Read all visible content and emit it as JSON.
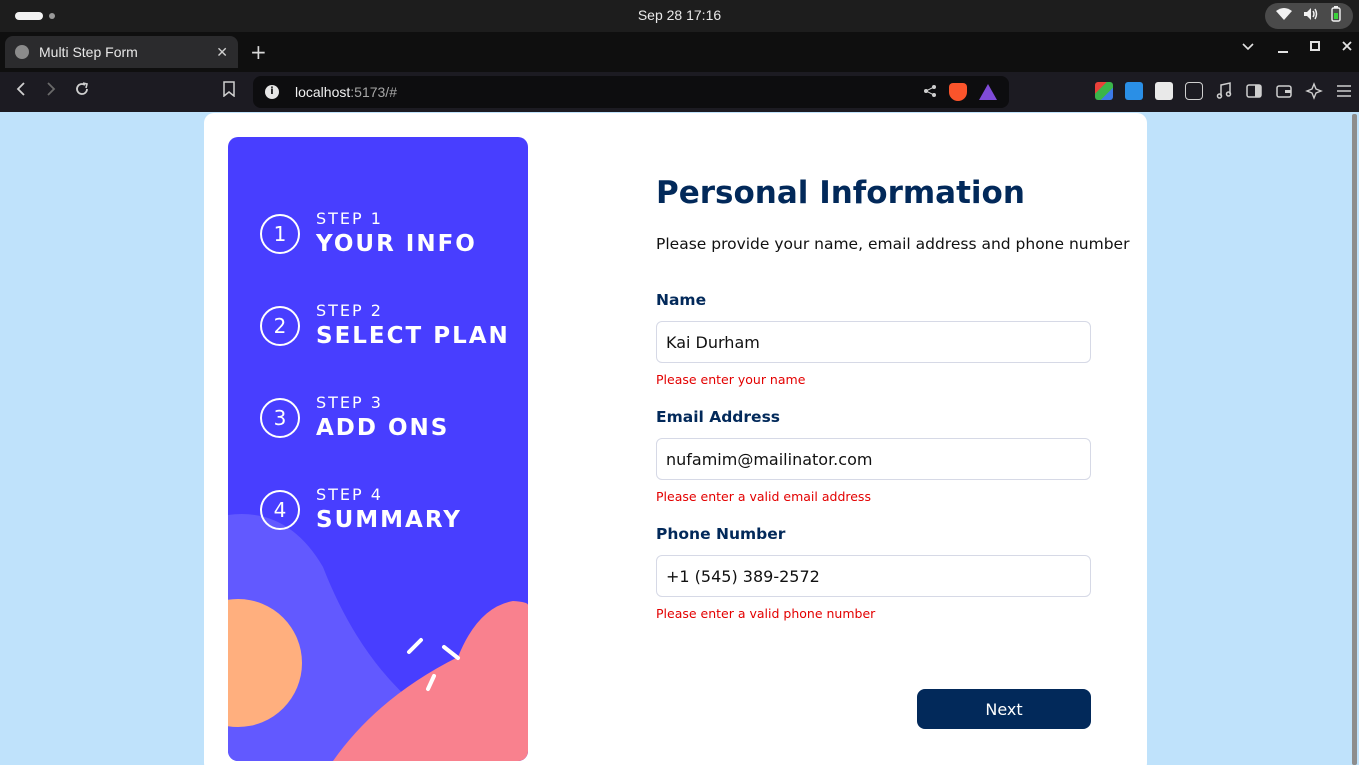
{
  "os": {
    "clock": "Sep 28  17:16",
    "tray_icons": [
      "wifi-icon",
      "volume-icon",
      "battery-icon"
    ]
  },
  "browser": {
    "tab_title": "Multi Step Form",
    "tab_close": "✕",
    "new_tab": "+",
    "url_host": "localhost",
    "url_rest": ":5173/#",
    "extensions": [
      "extension-multicolor-icon",
      "extension-fi-icon",
      "extension-formula-icon",
      "puzzle-icon",
      "music-icon",
      "sidebar-icon",
      "wallet-icon",
      "leo-icon",
      "menu-icon"
    ]
  },
  "sidebar": {
    "steps": [
      {
        "number": "1",
        "label": "STEP 1",
        "title": "YOUR INFO"
      },
      {
        "number": "2",
        "label": "STEP 2",
        "title": "SELECT PLAN"
      },
      {
        "number": "3",
        "label": "STEP 3",
        "title": "ADD ONS"
      },
      {
        "number": "4",
        "label": "STEP 4",
        "title": "SUMMARY"
      }
    ]
  },
  "form": {
    "heading": "Personal Information",
    "subtitle": "Please provide your name, email address and phone number",
    "fields": [
      {
        "label": "Name",
        "value": "Kai Durham",
        "error": "Please enter your name"
      },
      {
        "label": "Email Address",
        "value": "nufamim@mailinator.com",
        "error": "Please enter a valid email address"
      },
      {
        "label": "Phone Number",
        "value": "+1 (545) 389-2572",
        "error": "Please enter a valid phone number"
      }
    ],
    "next_label": "Next"
  },
  "colors": {
    "sidebar_bg": "#483eff",
    "heading": "#02295a",
    "error": "#e30000",
    "page_bg": "#bfe2fb"
  }
}
